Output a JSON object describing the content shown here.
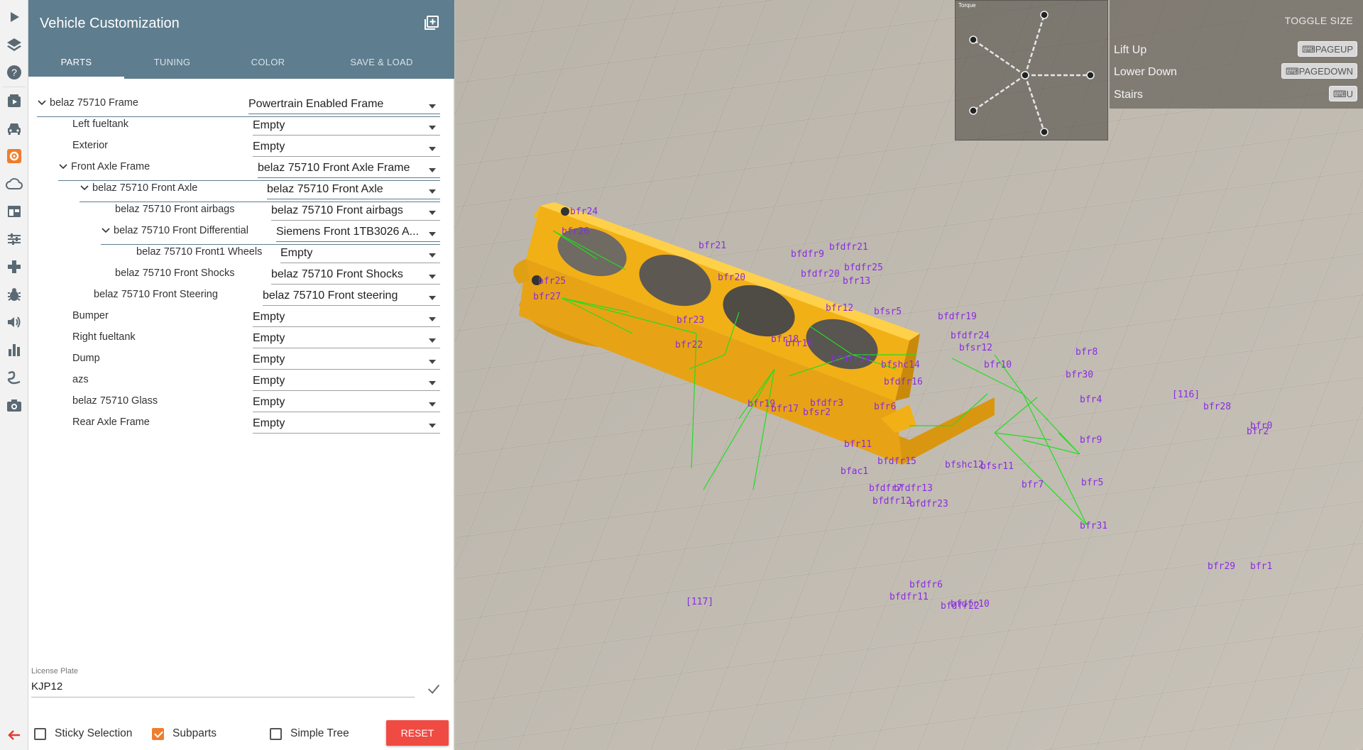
{
  "panel": {
    "title": "Vehicle Customization",
    "tabs": [
      {
        "label": "PARTS",
        "active": true
      },
      {
        "label": "TUNING",
        "active": false
      },
      {
        "label": "COLOR",
        "active": false
      },
      {
        "label": "SAVE & LOAD",
        "active": false
      }
    ]
  },
  "parts_tree": [
    {
      "label": "belaz 75710 Frame",
      "value": "Powertrain Enabled Frame",
      "expanded": true
    },
    {
      "label": "Left fueltank",
      "value": "Empty",
      "expanded": false
    },
    {
      "label": "Exterior",
      "value": "Empty",
      "expanded": false
    },
    {
      "label": "Front Axle Frame",
      "value": "belaz 75710 Front Axle Frame",
      "expanded": true
    },
    {
      "label": "belaz 75710 Front Axle",
      "value": "belaz 75710 Front Axle",
      "expanded": true
    },
    {
      "label": "belaz 75710 Front airbags",
      "value": "belaz 75710 Front airbags",
      "expanded": false
    },
    {
      "label": "belaz 75710 Front Differential",
      "value": "Siemens Front 1TB3026 A...",
      "expanded": true
    },
    {
      "label": "belaz 75710 Front1 Wheels",
      "value": "Empty",
      "expanded": false
    },
    {
      "label": "belaz 75710 Front Shocks",
      "value": "belaz 75710 Front Shocks",
      "expanded": false
    },
    {
      "label": "belaz 75710 Front Steering",
      "value": "belaz 75710 Front steering",
      "expanded": false
    },
    {
      "label": "Bumper",
      "value": "Empty",
      "expanded": false
    },
    {
      "label": "Right fueltank",
      "value": "Empty",
      "expanded": false
    },
    {
      "label": "Dump",
      "value": "Empty",
      "expanded": false
    },
    {
      "label": "azs",
      "value": "Empty",
      "expanded": false
    },
    {
      "label": "belaz 75710 Glass",
      "value": "Empty",
      "expanded": false
    },
    {
      "label": "Rear Axle Frame",
      "value": "Empty",
      "expanded": false
    }
  ],
  "license_plate": {
    "label": "License Plate",
    "value": "KJP12"
  },
  "options": {
    "sticky_selection": {
      "label": "Sticky Selection",
      "checked": false
    },
    "subparts": {
      "label": "Subparts",
      "checked": true
    },
    "simple_tree": {
      "label": "Simple Tree",
      "checked": false
    }
  },
  "reset_label": "RESET",
  "minimap": {
    "title": "Torque"
  },
  "key_hints": {
    "toggle_label": "TOGGLE SIZE",
    "items": [
      {
        "label": "Lift Up",
        "key": "PAGEUP"
      },
      {
        "label": "Lower Down",
        "key": "PAGEDOWN"
      },
      {
        "label": "Stairs",
        "key": "U"
      }
    ]
  },
  "debug_labels": [
    "bfr24",
    "bfr26",
    "bfr21",
    "bfdfr21",
    "bfdfr9",
    "bfdfr25",
    "bfdfr20",
    "bfr25",
    "bfr27",
    "bfr20",
    "bfr13",
    "bfr12",
    "bfsr5",
    "bfdfr19",
    "bfr23",
    "bfdfr24",
    "bfr18",
    "bfr16",
    "bfsr12",
    "bfr8",
    "bfr22",
    "bfshc14",
    "bfdfr14",
    "bfr10",
    "bfr30",
    "bfdfr16",
    "[116]",
    "bfr4",
    "bfr28",
    "bfr0",
    "bfr2",
    "bfr19",
    "bfr17",
    "bfsr2",
    "bfdfr3",
    "bfr6",
    "bfr9",
    "bfr11",
    "bfshc12",
    "bfdfr15",
    "bfsr11",
    "bfac1",
    "bfdfr7",
    "bfdfr13",
    "bfr7",
    "bfr5",
    "bfdfr12",
    "bfdfr23",
    "bfr31",
    "bfr29",
    "bfr1",
    "[117]",
    "bfdfr6",
    "bfdfr11",
    "bfdfr10",
    "bfdfr22"
  ],
  "colors": {
    "header": "#5e7d8e",
    "accent": "#ef7d2e",
    "reset": "#f04b42",
    "frame": "#f2b017",
    "debug_text": "#8a2be2",
    "debug_line": "#22dd22"
  }
}
